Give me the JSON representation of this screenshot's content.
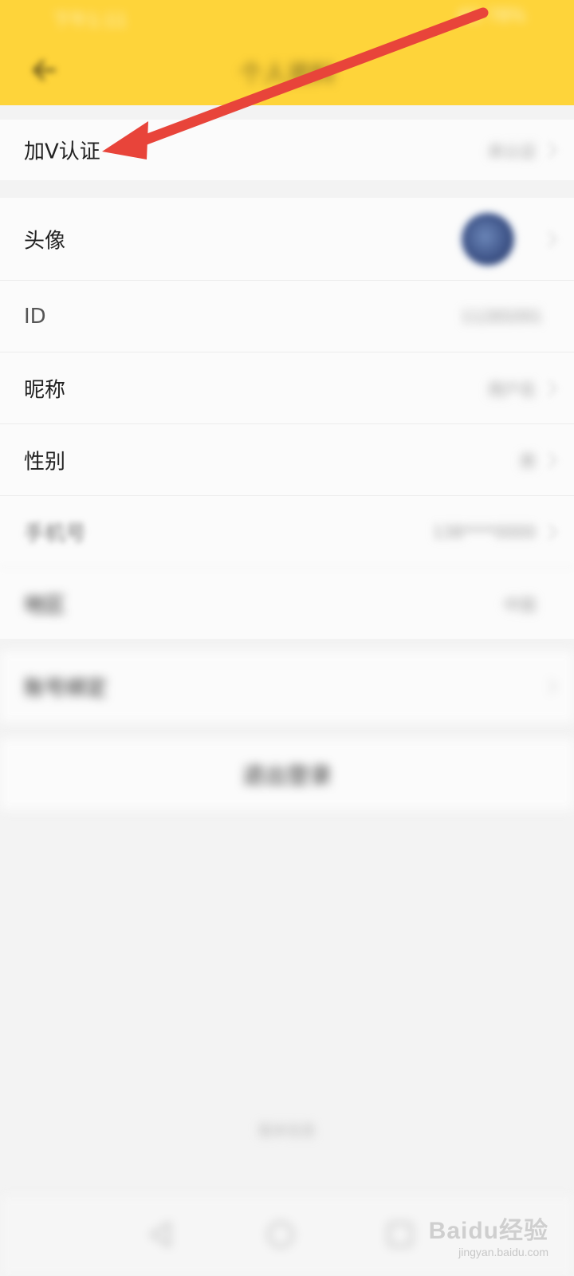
{
  "status_bar": {
    "time": "下午1:11",
    "right": "4G 78%"
  },
  "header": {
    "title": "个人资料",
    "back_icon": "arrow-left-icon"
  },
  "verification": {
    "label": "加V认证",
    "value": "未认证"
  },
  "profile": {
    "avatar_label": "头像",
    "id_label": "ID",
    "id_value": "11285091",
    "nickname_label": "昵称",
    "nickname_value": "用户名",
    "gender_label": "性别",
    "gender_value": "男",
    "phone_label": "手机号",
    "phone_value": "138****0000",
    "region_label": "地区",
    "region_value": "中国"
  },
  "account": {
    "label": "账号绑定"
  },
  "logout": {
    "label": "退出登录"
  },
  "footer_note": "版本信息",
  "watermark": {
    "logo": "Baidu经验",
    "url": "jingyan.baidu.com"
  },
  "colors": {
    "header": "#fed43a",
    "arrow": "#e8443a"
  }
}
